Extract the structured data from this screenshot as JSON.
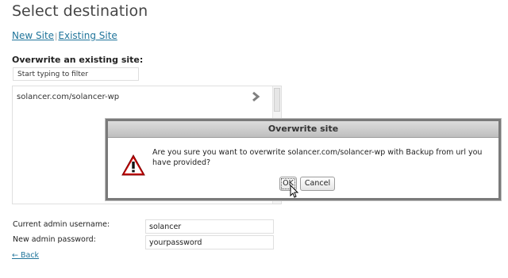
{
  "page": {
    "title": "Select destination",
    "new_site_link": "New Site",
    "separator": "|",
    "existing_site_link": "Existing Site",
    "overwrite_label": "Overwrite an existing site:"
  },
  "filter": {
    "placeholder": "Start typing to filter",
    "value": "Start typing to filter"
  },
  "site_list": {
    "items": [
      "solancer.com/solancer-wp"
    ]
  },
  "form": {
    "username_label": "Current admin username:",
    "username_value": "solancer",
    "password_label": "New admin password:",
    "password_value": "yourpassword",
    "back_link": "← Back"
  },
  "dialog": {
    "title": "Overwrite site",
    "message": "Are you sure you want to overwrite solancer.com/solancer-wp with Backup from url you have provided?",
    "ok_label": "OK",
    "cancel_label": "Cancel",
    "icon": "warning-icon"
  },
  "colors": {
    "link": "#21759b",
    "warning": "#cc0000",
    "dialog_border": "#7a7a7a"
  }
}
